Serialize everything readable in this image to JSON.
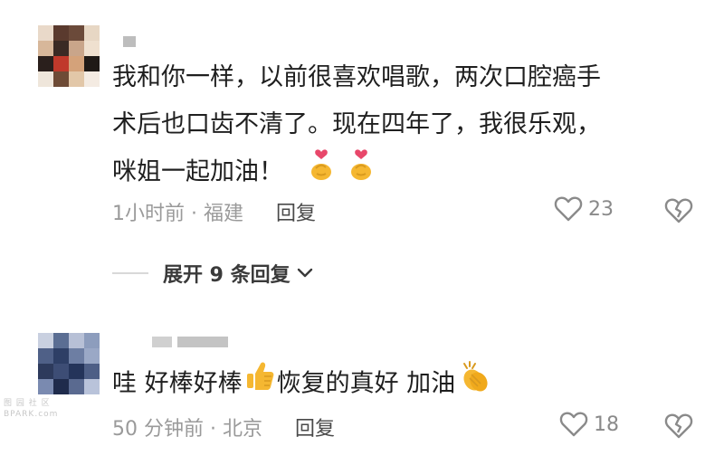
{
  "comments": [
    {
      "text_line1": "我和你一样，以前很喜欢唱歌，两次口腔癌手",
      "text_line2": "术后也口齿不清了。现在四年了，我很乐观，",
      "text_line3": "咪姐一起加油！",
      "time_location": "1小时前 · 福建",
      "reply_label": "回复",
      "like_count": "23",
      "emojis": [
        "finger-heart-icon",
        "finger-heart-icon"
      ]
    },
    {
      "text_part1": "哇 好棒好棒",
      "text_part2": "恢复的真好 加油",
      "time_location": "50 分钟前 · 北京",
      "reply_label": "回复",
      "like_count": "18",
      "emojis": [
        "thumbs-up-icon",
        "clapping-hands-icon"
      ]
    }
  ],
  "expand_replies_label": "展开 9 条回复",
  "watermark": {
    "line1": "图 园 社 区",
    "line2": "BPARK.com"
  },
  "colors": {
    "text": "#1f1f1f",
    "meta": "#9a9a9a",
    "icon": "#8a8a8a",
    "emoji": "#f5b731",
    "heart": "#e8476a"
  }
}
